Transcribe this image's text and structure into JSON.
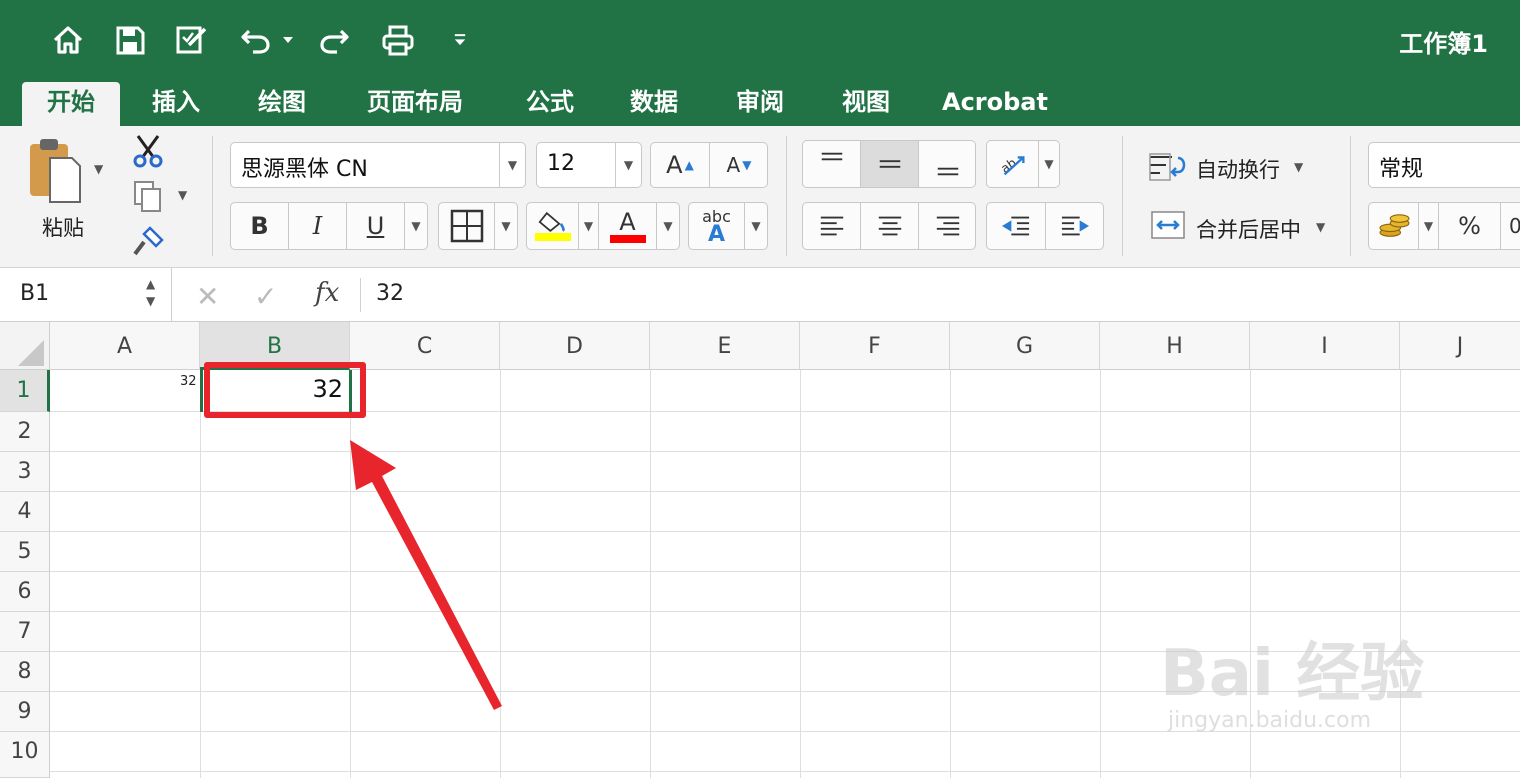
{
  "app": {
    "doc_title": "工作簿1",
    "accent_color": "#217346"
  },
  "quick_access": [
    "home-icon",
    "save-icon",
    "edit-icon",
    "undo-icon",
    "redo-icon",
    "print-icon",
    "customize-icon"
  ],
  "tabs": [
    "开始",
    "插入",
    "绘图",
    "页面布局",
    "公式",
    "数据",
    "审阅",
    "视图",
    "Acrobat"
  ],
  "ribbon": {
    "paste_label": "粘贴",
    "font_name": "思源黑体 CN",
    "font_size": "12",
    "bold": "B",
    "italic": "I",
    "underline": "U",
    "font_color_label": "A",
    "phonetic_label": "abc",
    "phonetic_letter": "A",
    "grow_font": "A",
    "shrink_font": "A",
    "wrap_text_label": "自动换行",
    "merge_center_label": "合并后居中",
    "number_format": "常规",
    "percent_label": "%",
    "comma_partial": "0",
    "fill_color": "#ffff00",
    "text_color": "#ff0000"
  },
  "formula_bar": {
    "name_box": "B1",
    "cancel": "✕",
    "confirm": "✓",
    "fx": "fx",
    "value": "32"
  },
  "sheet": {
    "columns": [
      "A",
      "B",
      "C",
      "D",
      "E",
      "F",
      "G",
      "H",
      "I",
      "J"
    ],
    "rows": [
      "1",
      "2",
      "3",
      "4",
      "5",
      "6",
      "7",
      "8",
      "9",
      "10"
    ],
    "selected_column": "B",
    "selected_row": "1",
    "cells": {
      "A1": "32",
      "B1": "32"
    }
  },
  "annotation": {
    "highlight_color": "#e8242c"
  },
  "watermark": {
    "brand": "Bai 经验",
    "url": "jingyan.baidu.com"
  }
}
